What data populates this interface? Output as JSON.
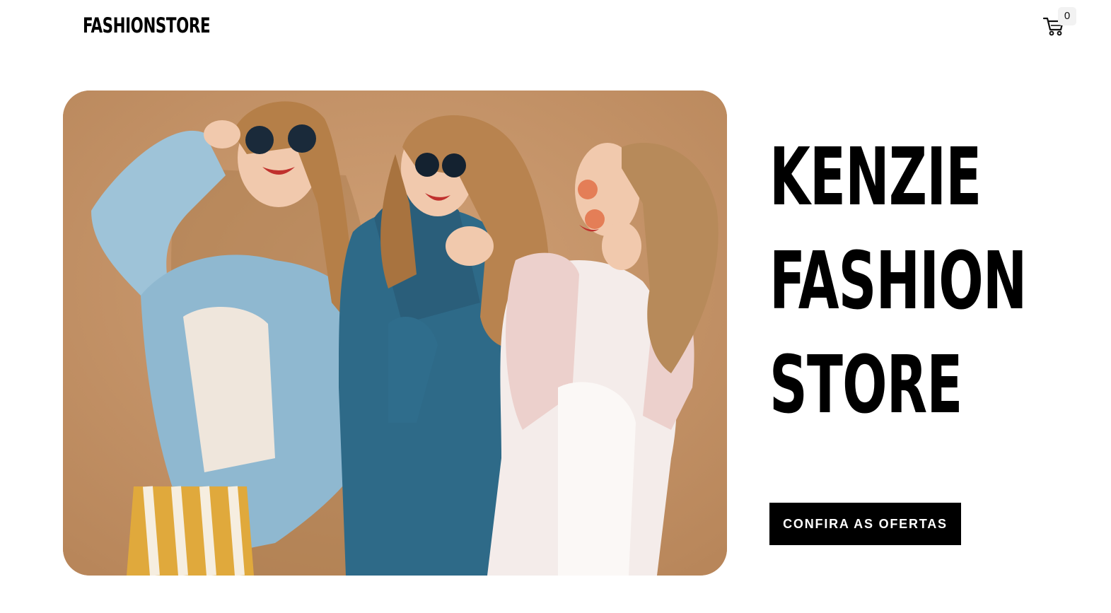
{
  "header": {
    "brand": "FASHIONSTORE",
    "cart": {
      "icon": "cart-icon",
      "count": "0"
    }
  },
  "hero": {
    "image": "hero-photo-three-women-laughing",
    "title_lines": [
      "KENZIE",
      "FASHION",
      "STORE"
    ],
    "cta_label": "CONFIRA AS OFERTAS"
  },
  "colors": {
    "background": "#ffffff",
    "text": "#000000",
    "button_bg": "#000000",
    "button_text": "#ffffff",
    "photo_backdrop": "#c28f63"
  }
}
